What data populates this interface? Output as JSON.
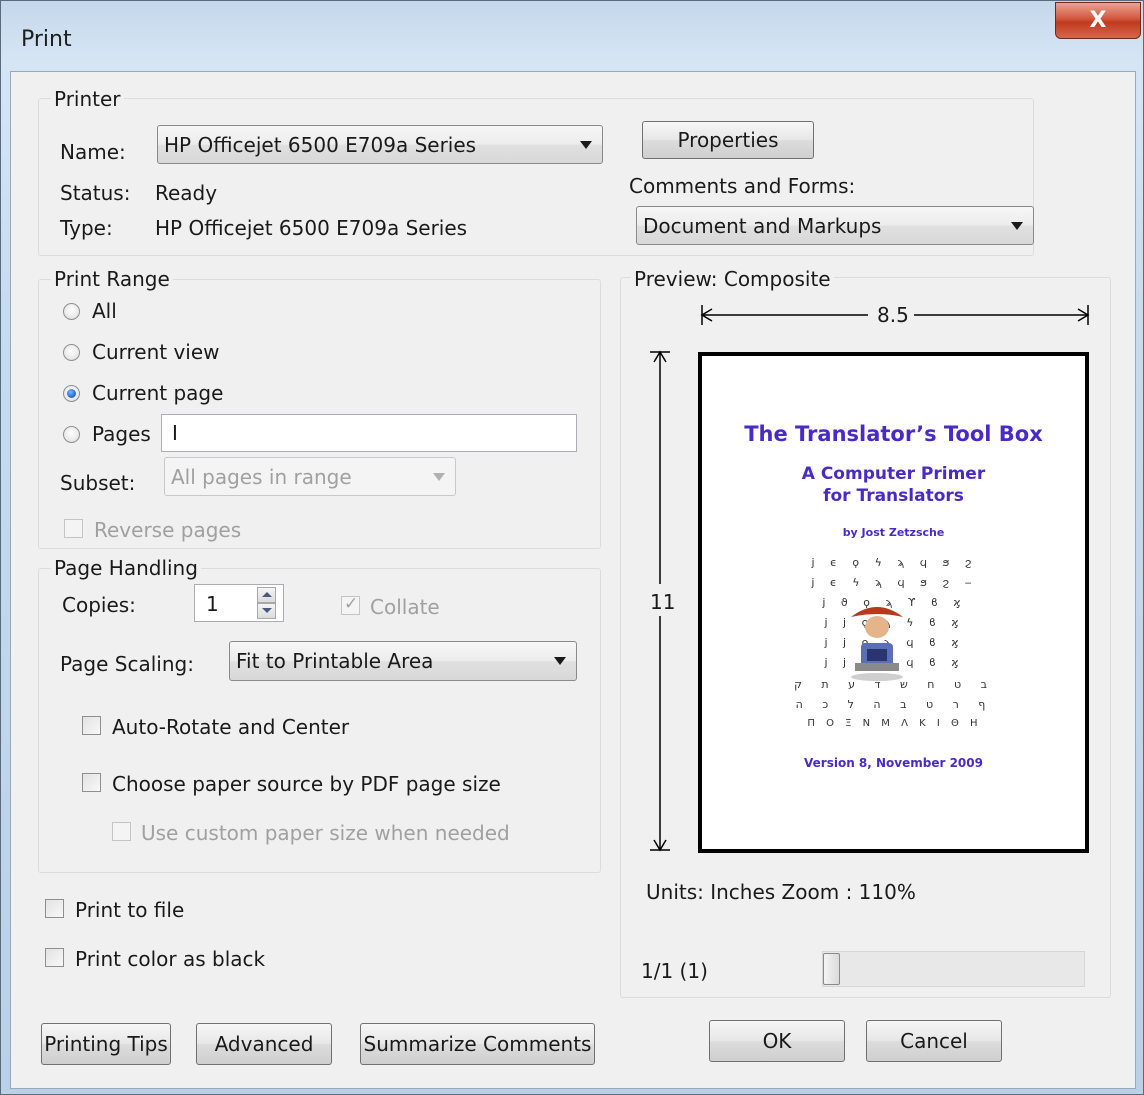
{
  "window": {
    "title": "Print",
    "close_glyph": "X"
  },
  "printer": {
    "group_label": "Printer",
    "name_label": "Name:",
    "name_value": "HP Officejet 6500 E709a Series",
    "status_label": "Status:",
    "status_value": "Ready",
    "type_label": "Type:",
    "type_value": "HP Officejet 6500 E709a Series",
    "properties_button": "Properties",
    "comments_label": "Comments and Forms:",
    "comments_value": "Document and Markups"
  },
  "print_range": {
    "group_label": "Print Range",
    "options": [
      "All",
      "Current view",
      "Current page",
      "Pages"
    ],
    "selected": "Current page",
    "pages_value": "I",
    "subset_label": "Subset:",
    "subset_value": "All pages in range",
    "reverse_label": "Reverse pages"
  },
  "page_handling": {
    "group_label": "Page Handling",
    "copies_label": "Copies:",
    "copies_value": "1",
    "collate_label": "Collate",
    "collate_checked": true,
    "scaling_label": "Page Scaling:",
    "scaling_value": "Fit to Printable Area",
    "auto_rotate_label": "Auto-Rotate and Center",
    "paper_source_label": "Choose paper source by PDF page size",
    "custom_paper_label": "Use custom paper size when needed"
  },
  "options": {
    "print_to_file": "Print to file",
    "print_color_black": "Print color as black"
  },
  "preview": {
    "group_label": "Preview: Composite",
    "width_dim": "8.5",
    "height_dim": "11",
    "page": {
      "title": "The Translator’s Tool Box",
      "subtitle_1": "A Computer Primer",
      "subtitle_2": "for Translators",
      "author": "by Jost Zetzsche",
      "glyph_rows": [
        "ϳ ϵ ϙ ϟ ϡ ϥ ϧ ϩ",
        "ϳ ϵ   ϟ ϡ ϥ ϧ ϩ ‒",
        "ϳ ϑ ϙ   ϡ ϒ ϐ ϗ",
        "ϳ ϳ ϙ   ϡ ϟ ϐ ϗ",
        "ϳ ϳ ϙ   ϡ ϥ ϐ ϗ",
        "ϳ ϳ ϙ   ϡ ϥ ϐ ϗ",
        "ב ט ח ש ד ע ת ק",
        "ף ר ט ב ה ל כ ה",
        "Π Ο Ξ Ν Μ Λ Κ Ι Θ Η"
      ],
      "version": "Version 8, November 2009"
    },
    "units_zoom": "Units: Inches Zoom : 110%",
    "page_counter": "1/1 (1)"
  },
  "buttons": {
    "printing_tips": "Printing Tips",
    "advanced": "Advanced",
    "summarize": "Summarize Comments",
    "ok": "OK",
    "cancel": "Cancel"
  },
  "colors": {
    "accent": "#2a6fd1",
    "preview_title": "#4a2ac7"
  }
}
